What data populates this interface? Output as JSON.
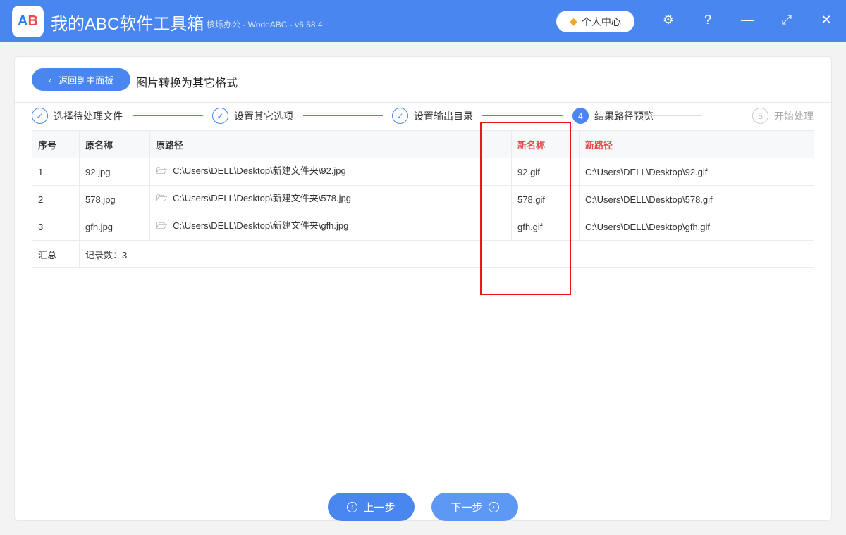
{
  "app": {
    "logo": "AB",
    "title": "我的ABC软件工具箱",
    "subtitle": "核烁办公 - WodeABC - v6.58.4",
    "user_center": "个人中心"
  },
  "header": {
    "back": "返回到主面板",
    "title": "图片转换为其它格式"
  },
  "steps": [
    {
      "num": "1",
      "label": "选择待处理文件"
    },
    {
      "num": "2",
      "label": "设置其它选项"
    },
    {
      "num": "3",
      "label": "设置输出目录"
    },
    {
      "num": "4",
      "label": "结果路径预览"
    },
    {
      "num": "5",
      "label": "开始处理"
    }
  ],
  "table": {
    "headers": [
      "序号",
      "原名称",
      "原路径",
      "新名称",
      "新路径"
    ],
    "rows": [
      [
        "1",
        "92.jpg",
        "C:\\Users\\DELL\\Desktop\\新建文件夹\\92.jpg",
        "92.gif",
        "C:\\Users\\DELL\\Desktop\\92.gif"
      ],
      [
        "2",
        "578.jpg",
        "C:\\Users\\DELL\\Desktop\\新建文件夹\\578.jpg",
        "578.gif",
        "C:\\Users\\DELL\\Desktop\\578.gif"
      ],
      [
        "3",
        "gfh.jpg",
        "C:\\Users\\DELL\\Desktop\\新建文件夹\\gfh.jpg",
        "gfh.gif",
        "C:\\Users\\DELL\\Desktop\\gfh.gif"
      ]
    ],
    "summary_label": "汇总",
    "summary_value": "记录数：3"
  },
  "footer": {
    "prev": "上一步",
    "next": "下一步"
  }
}
